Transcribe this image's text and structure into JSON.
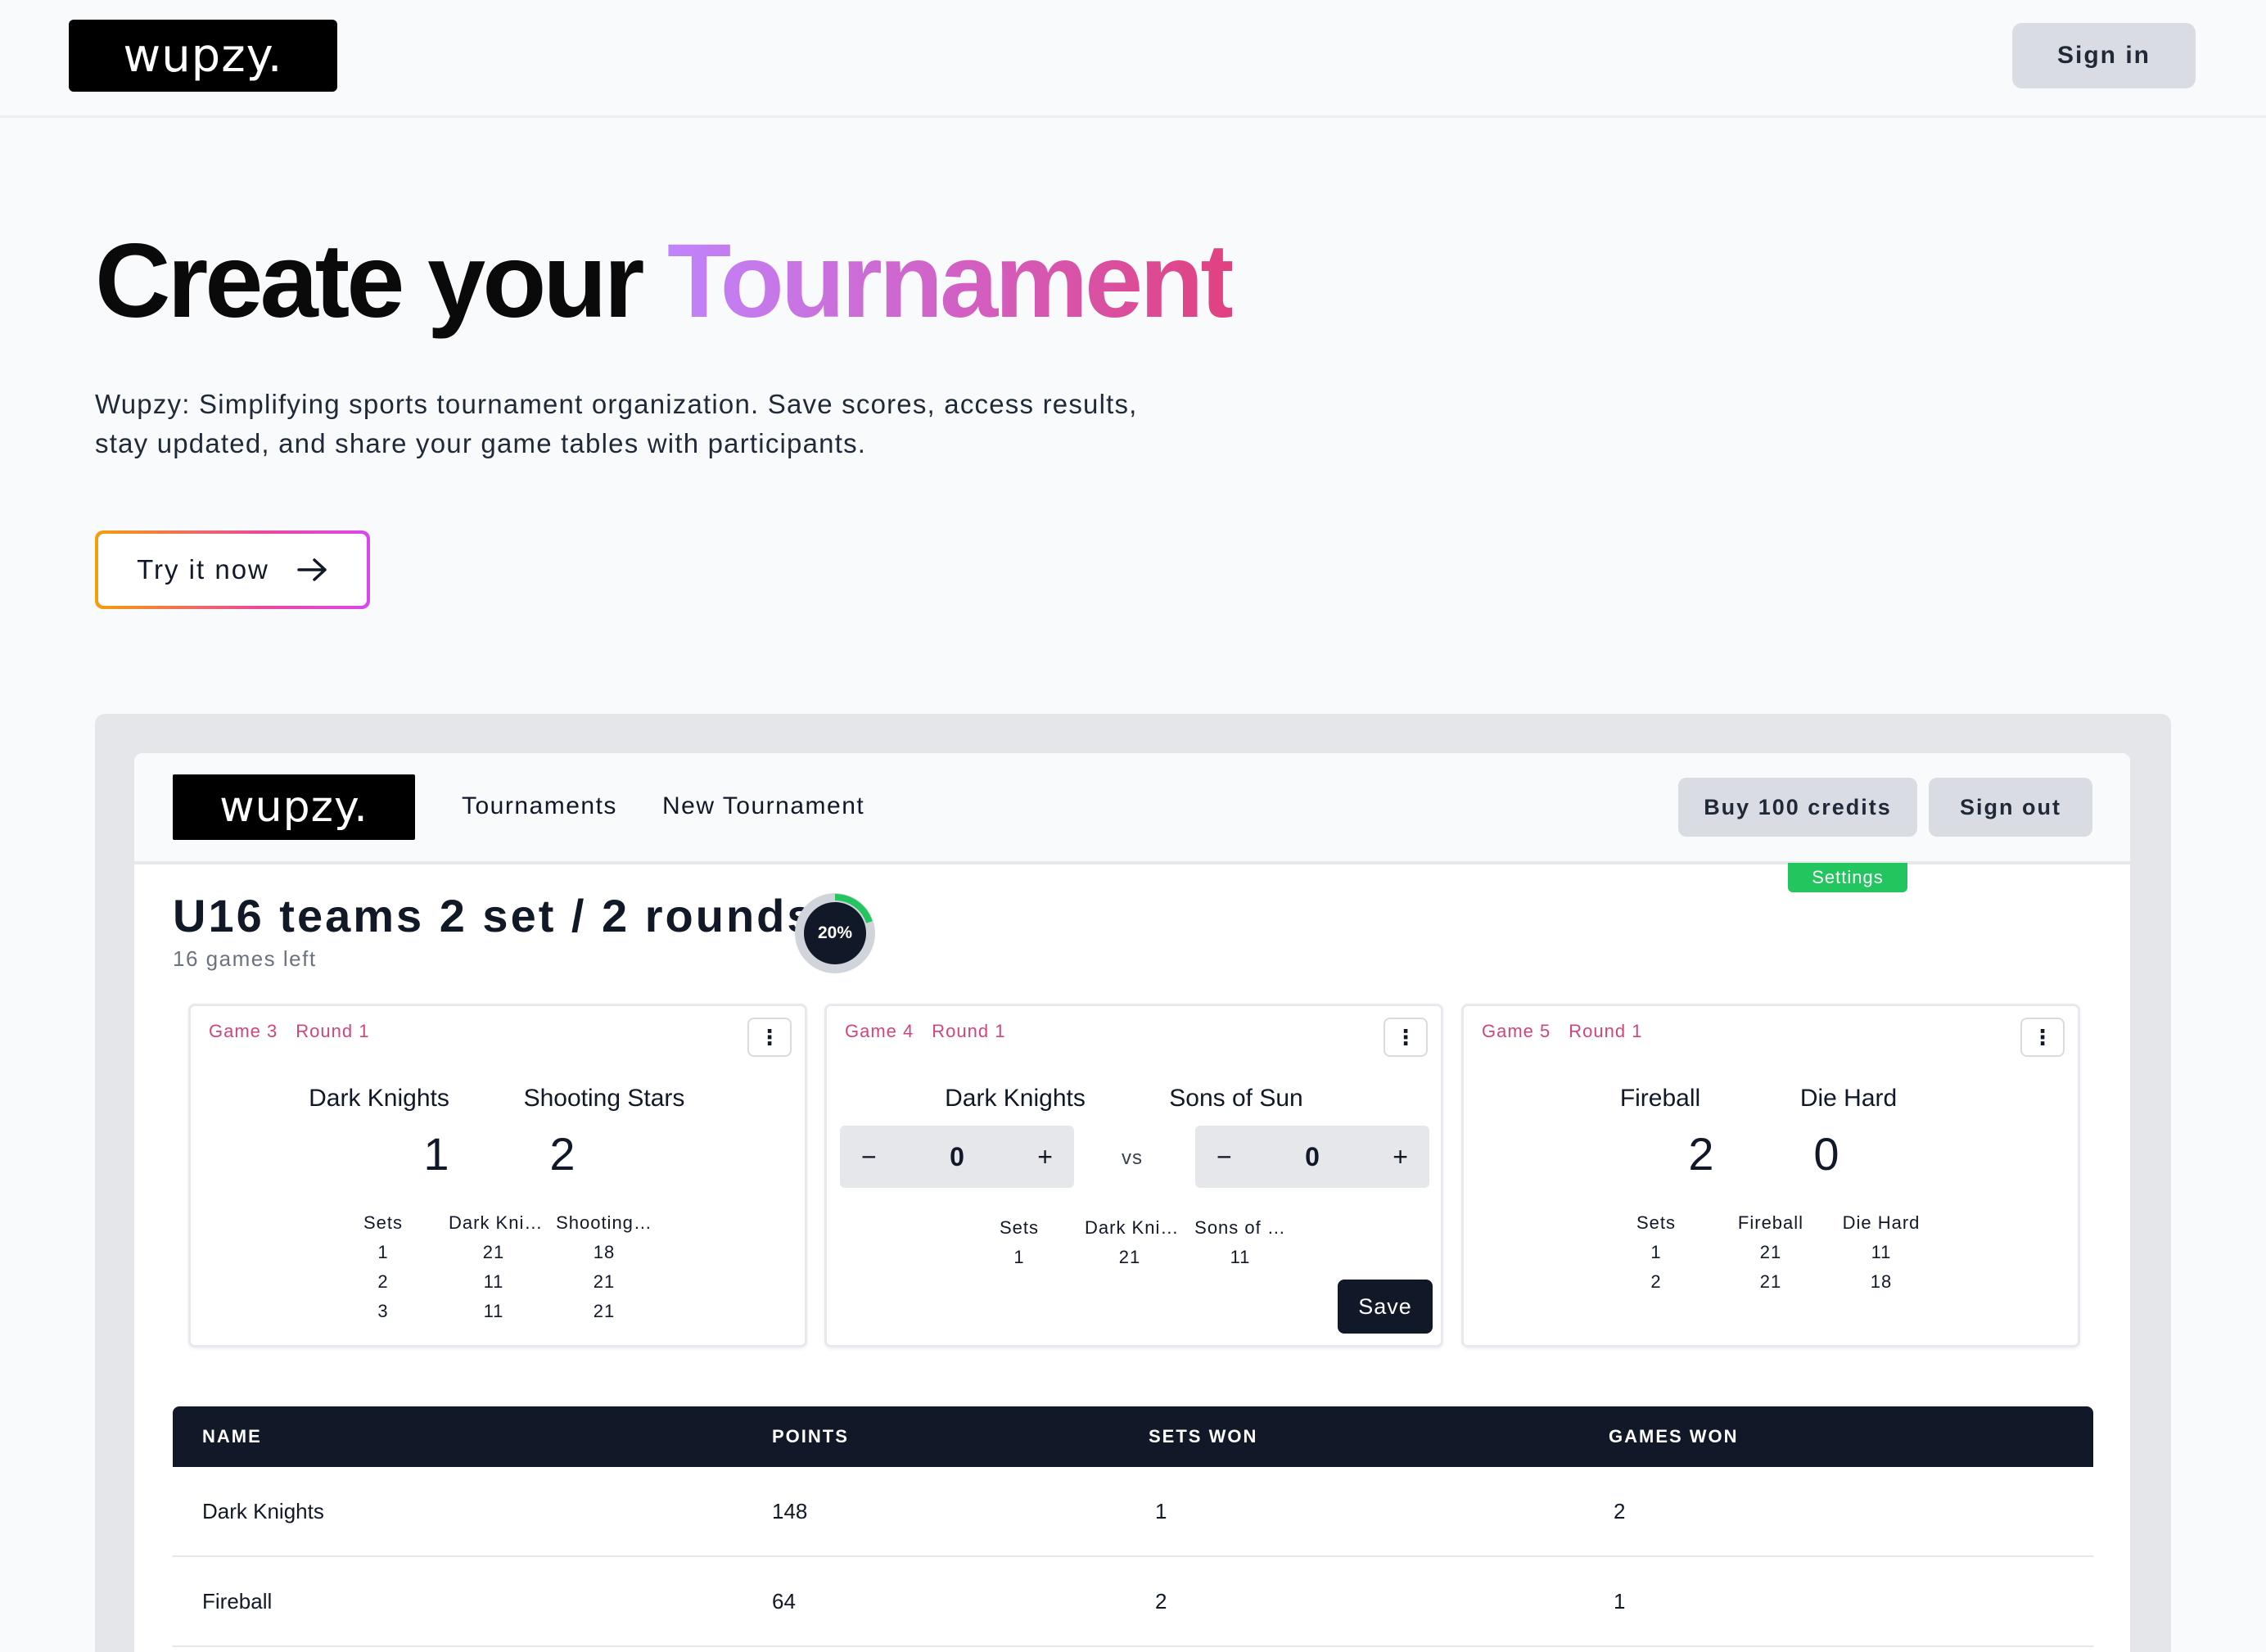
{
  "header": {
    "logo": "wupzy.",
    "signin_label": "Sign in"
  },
  "hero": {
    "title_plain": "Create your",
    "title_highlight": "Tournament",
    "subtitle": "Wupzy: Simplifying sports tournament organization. Save scores, access results, stay updated, and share your game tables with participants.",
    "cta_label": "Try it now"
  },
  "app": {
    "logo": "wupzy.",
    "nav": [
      "Tournaments",
      "New Tournament"
    ],
    "buy_label": "Buy 100 credits",
    "signout_label": "Sign out",
    "settings_label": "Settings",
    "tournament_title": "U16 teams 2 set / 2 rounds",
    "games_left": "16 games left",
    "progress_label": "20%",
    "progress_value": 0.2,
    "colors": {
      "accent_pink": "#d0457e",
      "progress_green": "#22c55e",
      "dark": "#111827"
    }
  },
  "games": [
    {
      "game": "Game 3",
      "round": "Round 1",
      "team_a": "Dark Knights",
      "team_b": "Shooting Stars",
      "score_a": "1",
      "score_b": "2",
      "sets_header": [
        "Sets",
        "Dark Kni…",
        "Shooting…"
      ],
      "sets": [
        [
          "1",
          "21",
          "18"
        ],
        [
          "2",
          "11",
          "21"
        ],
        [
          "3",
          "11",
          "21"
        ]
      ]
    },
    {
      "game": "Game 4",
      "round": "Round 1",
      "team_a": "Dark Knights",
      "team_b": "Sons of Sun",
      "stepper_a": "0",
      "stepper_b": "0",
      "vs_label": "vs",
      "sets_header": [
        "Sets",
        "Dark Kni…",
        "Sons of …"
      ],
      "sets": [
        [
          "1",
          "21",
          "11"
        ]
      ],
      "save_label": "Save"
    },
    {
      "game": "Game 5",
      "round": "Round 1",
      "team_a": "Fireball",
      "team_b": "Die Hard",
      "score_a": "2",
      "score_b": "0",
      "sets_header": [
        "Sets",
        "Fireball",
        "Die Hard"
      ],
      "sets": [
        [
          "1",
          "21",
          "11"
        ],
        [
          "2",
          "21",
          "18"
        ]
      ]
    }
  ],
  "standings": {
    "columns": [
      "NAME",
      "POINTS",
      "SETS WON",
      "GAMES WON"
    ],
    "rows": [
      [
        "Dark Knights",
        "148",
        "1",
        "2"
      ],
      [
        "Fireball",
        "64",
        "2",
        "1"
      ]
    ]
  }
}
